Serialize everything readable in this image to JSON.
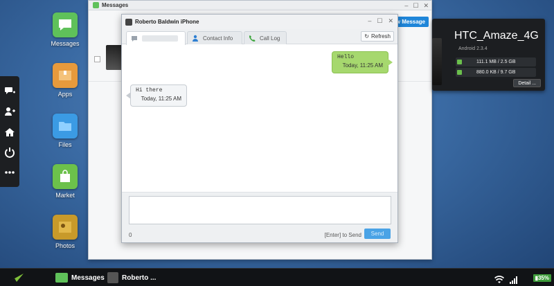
{
  "dock": {
    "icons": [
      "chat-plus-icon",
      "add-user-icon",
      "home-icon",
      "power-icon",
      "more-icon"
    ]
  },
  "desktop": {
    "apps": [
      {
        "label": "Messages",
        "icon": "speech-bubble-icon",
        "color": "#5fc15a"
      },
      {
        "label": "Apps",
        "icon": "box-icon",
        "color": "#e79a3c"
      },
      {
        "label": "Files",
        "icon": "folder-icon",
        "color": "#3b9be4"
      },
      {
        "label": "Market",
        "icon": "shopping-bag-icon",
        "color": "#6cc14b"
      },
      {
        "label": "Photos",
        "icon": "photo-icon",
        "color": "#c89a2a"
      }
    ]
  },
  "messages_window": {
    "title": "Messages",
    "new_message_label": "New Message"
  },
  "chat": {
    "title": "Roberto Baldwin iPhone",
    "tabs": [
      {
        "label": "",
        "icon": "chat-icon"
      },
      {
        "label": "Contact Info",
        "icon": "contact-icon"
      },
      {
        "label": "Call Log",
        "icon": "phone-icon"
      }
    ],
    "refresh_label": "Refresh",
    "messages": [
      {
        "direction": "out",
        "text": "Hello",
        "time": "Today, 11:25 AM"
      },
      {
        "direction": "in",
        "text": "Hi there",
        "time": "Today, 11:25 AM"
      }
    ],
    "compose": {
      "value": "",
      "char_count": "0",
      "hint": "[Enter] to Send",
      "send_label": "Send"
    }
  },
  "device": {
    "name": "HTC_Amaze_4G",
    "os": "Android 2.3.4",
    "storage": [
      {
        "text": "111.1 MB / 2.5 GB",
        "icon": "sd-card-icon"
      },
      {
        "text": "880.0 KB / 9.7 GB",
        "icon": "memory-icon"
      }
    ],
    "detail_label": "Detail ..."
  },
  "taskbar": {
    "items": [
      {
        "label": "Messages",
        "icon": "speech-bubble-icon"
      },
      {
        "label": "Roberto ...",
        "icon": "avatar-icon"
      }
    ],
    "battery": "35%",
    "colors": {
      "accent": "#1f86d9",
      "bubble_out": "#a6d86e"
    }
  }
}
